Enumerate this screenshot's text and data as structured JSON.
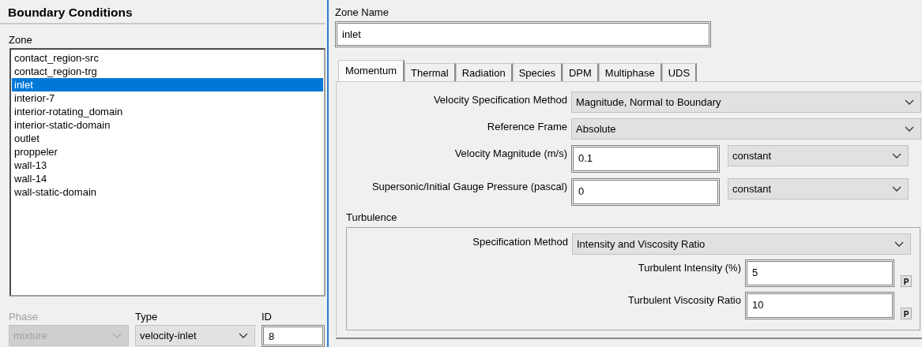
{
  "panel_title": "Boundary Conditions",
  "zone": {
    "label": "Zone",
    "items": [
      {
        "label": "contact_region-src",
        "selected": false
      },
      {
        "label": "contact_region-trg",
        "selected": false
      },
      {
        "label": "inlet",
        "selected": true
      },
      {
        "label": "interior-7",
        "selected": false
      },
      {
        "label": "interior-rotating_domain",
        "selected": false
      },
      {
        "label": "interior-static-domain",
        "selected": false
      },
      {
        "label": "outlet",
        "selected": false
      },
      {
        "label": "proppeler",
        "selected": false
      },
      {
        "label": "wall-13",
        "selected": false
      },
      {
        "label": "wall-14",
        "selected": false
      },
      {
        "label": "wall-static-domain",
        "selected": false
      }
    ]
  },
  "phase": {
    "label": "Phase",
    "value": "mixture",
    "disabled": true
  },
  "type": {
    "label": "Type",
    "value": "velocity-inlet",
    "disabled": false
  },
  "id": {
    "label": "ID",
    "value": "8"
  },
  "zone_name": {
    "label": "Zone Name",
    "value": "inlet"
  },
  "tabs": [
    {
      "label": "Momentum",
      "selected": true
    },
    {
      "label": "Thermal",
      "selected": false
    },
    {
      "label": "Radiation",
      "selected": false
    },
    {
      "label": "Species",
      "selected": false
    },
    {
      "label": "DPM",
      "selected": false
    },
    {
      "label": "Multiphase",
      "selected": false
    },
    {
      "label": "UDS",
      "selected": false
    }
  ],
  "momentum": [
    {
      "kind": "select",
      "label": "Velocity Specification Method",
      "value": "Magnitude, Normal to Boundary"
    },
    {
      "kind": "select",
      "label": "Reference Frame",
      "value": "Absolute"
    },
    {
      "kind": "input",
      "label": "Velocity Magnitude (m/s)",
      "value": "0.1",
      "option": "constant"
    },
    {
      "kind": "input",
      "label": "Supersonic/Initial Gauge Pressure (pascal)",
      "value": "0",
      "option": "constant"
    }
  ],
  "turbulence": {
    "title": "Turbulence",
    "rows": [
      {
        "kind": "select",
        "label": "Specification Method",
        "value": "Intensity and Viscosity Ratio"
      },
      {
        "kind": "param",
        "label": "Turbulent Intensity (%)",
        "value": "5",
        "button": "P"
      },
      {
        "kind": "param",
        "label": "Turbulent Viscosity Ratio",
        "value": "10",
        "button": "P"
      }
    ]
  }
}
